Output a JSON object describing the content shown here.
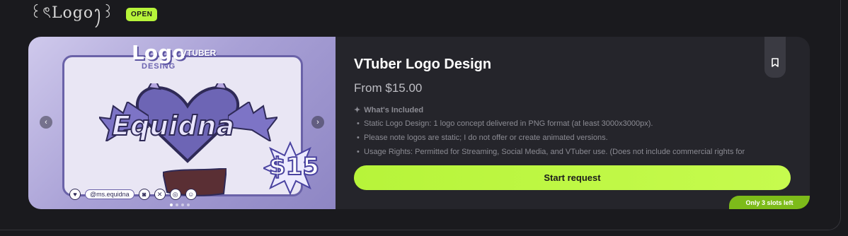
{
  "header": {
    "logo_text": "꒰ৎLogoꫂ꒱",
    "status_badge": "OPEN"
  },
  "card": {
    "media": {
      "title_line1": "Logo",
      "title_line2": "VTUBER",
      "title_line3": "DESING",
      "name_text": "Equidna",
      "price_sticker": "$15",
      "social_handle": "@ms.equidna",
      "nav_prev": "‹",
      "nav_next": "›"
    },
    "title": "VTuber Logo Design",
    "price": "From $15.00",
    "included_heading": "What's Included",
    "included_items": [
      "Static Logo Design: 1 logo concept delivered in PNG format (at least 3000x3000px).",
      "Please note logos are static; I do not offer or create animated versions.",
      "Usage Rights: Permitted for Streaming, Social Media, and VTuber use. (Does not include commercial rights for"
    ],
    "cta_label": "Start request",
    "slots_label": "Only 3 slots left",
    "icons": [
      "bookmark-icon",
      "sparkle-icon",
      "chevron-left-icon",
      "chevron-right-icon"
    ],
    "colors": {
      "accent": "#b7f43a",
      "slots_bg": "#7dbb1a",
      "card_bg": "#25252b"
    }
  }
}
